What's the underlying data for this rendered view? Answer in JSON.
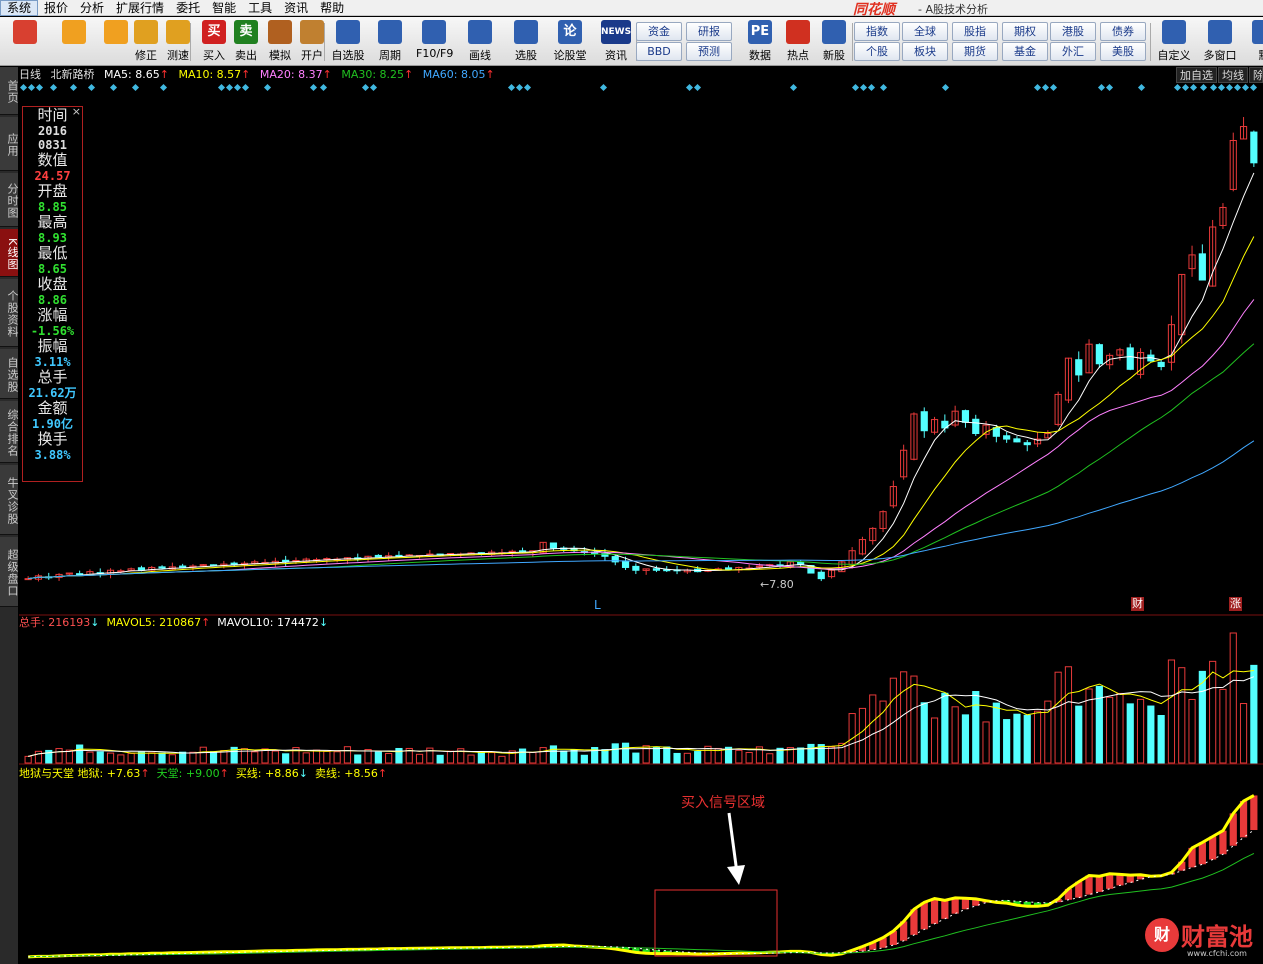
{
  "menu": {
    "items": [
      "系统",
      "报价",
      "分析",
      "扩展行情",
      "委托",
      "智能",
      "工具",
      "资讯",
      "帮助"
    ],
    "app_logo": "同花顺",
    "app_title": "- A股技术分析"
  },
  "toolbar": {
    "buttons": [
      {
        "label": "",
        "icon": "layout-icon",
        "color": "#d84030"
      },
      {
        "label": "",
        "icon": "back-arrow-icon",
        "color": "#f0a020"
      },
      {
        "label": "",
        "icon": "up-down-arrows-icon",
        "color": "#f0a020"
      },
      {
        "label": "修正",
        "icon": "clock-icon",
        "color": "#e0a020"
      },
      {
        "label": "测速",
        "icon": "stopwatch-icon",
        "color": "#e0a020"
      },
      {
        "label": "买入",
        "icon": "buy-icon",
        "glyph": "买",
        "color": "#d02020"
      },
      {
        "label": "卖出",
        "icon": "sell-icon",
        "glyph": "卖",
        "color": "#208020"
      },
      {
        "label": "模拟",
        "icon": "gavel-icon",
        "color": "#b06020"
      },
      {
        "label": "开户",
        "icon": "lock-icon",
        "color": "#c08030"
      },
      {
        "label": "自选股",
        "icon": "star-folder-icon",
        "color": "#3060b0"
      },
      {
        "label": "周期",
        "icon": "cycle-clock-icon",
        "color": "#3060b0"
      },
      {
        "label": "F10/F9",
        "icon": "f10-icon",
        "color": "#3060b0"
      },
      {
        "label": "画线",
        "icon": "pen-icon",
        "color": "#3060b0"
      },
      {
        "label": "选股",
        "icon": "screen-select-icon",
        "color": "#3060b0"
      },
      {
        "label": "论股堂",
        "icon": "discuss-icon",
        "glyph": "论",
        "color": "#3060b0"
      },
      {
        "label": "资讯",
        "icon": "news-icon",
        "glyph": "NEWS",
        "color": "#1a3a8a"
      },
      {
        "label": "数据",
        "icon": "pe-data-icon",
        "glyph": "PE",
        "color": "#3060b0"
      },
      {
        "label": "热点",
        "icon": "hot-fire-icon",
        "color": "#d03020"
      },
      {
        "label": "新股",
        "icon": "ipo-icon",
        "color": "#3060b0"
      },
      {
        "label": "自定义",
        "icon": "custom-icon",
        "color": "#3060b0"
      },
      {
        "label": "多窗口",
        "icon": "multi-window-icon",
        "color": "#3060b0"
      },
      {
        "label": "默",
        "icon": "default-icon",
        "color": "#3060b0"
      }
    ],
    "mini_buttons": [
      {
        "label": "资金"
      },
      {
        "label": "BBD"
      },
      {
        "label": "研报"
      },
      {
        "label": "预测"
      },
      {
        "label": "指数"
      },
      {
        "label": "个股"
      },
      {
        "label": "全球"
      },
      {
        "label": "板块"
      },
      {
        "label": "股指"
      },
      {
        "label": "期货"
      },
      {
        "label": "期权"
      },
      {
        "label": "基金"
      },
      {
        "label": "港股"
      },
      {
        "label": "外汇"
      },
      {
        "label": "债券"
      },
      {
        "label": "美股"
      }
    ]
  },
  "left_tabs": [
    "首页",
    "应用",
    "分时图",
    "K线图",
    "个股资料",
    "自选股",
    "综合排名",
    "牛叉诊股",
    "超级盘口"
  ],
  "header": {
    "period": "日线",
    "stock_name": "北新路桥",
    "ma5_label": "MA5:",
    "ma5": "8.65",
    "ma10_label": "MA10:",
    "ma10": "8.57",
    "ma20_label": "MA20:",
    "ma20": "8.37",
    "ma30_label": "MA30:",
    "ma30": "8.25",
    "ma60_label": "MA60:",
    "ma60": "8.05",
    "add_self": "加自选",
    "ma_line": "均线",
    "remove": "除"
  },
  "info": {
    "time_label": "时间",
    "date_year": "2016",
    "date_md": "0831",
    "value_label": "数值",
    "value": "24.57",
    "open_label": "开盘",
    "open": "8.85",
    "high_label": "最高",
    "high": "8.93",
    "low_label": "最低",
    "low": "8.65",
    "close_label": "收盘",
    "close": "8.86",
    "change_label": "涨幅",
    "change": "-1.56%",
    "amplitude_label": "振幅",
    "amplitude": "3.11%",
    "volume_label": "总手",
    "volume": "21.62万",
    "amount_label": "金额",
    "amount": "1.90亿",
    "turnover_label": "换手",
    "turnover": "3.88%"
  },
  "price_pane": {
    "low_marker": "7.80",
    "l_marker": "L",
    "cai_marker": "财",
    "zhang_marker": "涨"
  },
  "volume_pane": {
    "total_label": "总手:",
    "total": "216193",
    "mavol5_label": "MAVOL5:",
    "mavol5": "210867",
    "mavol10_label": "MAVOL10:",
    "mavol10": "174472"
  },
  "indicator_pane": {
    "name": "地狱与天堂",
    "hell_label": "地狱:",
    "hell": "+7.63",
    "heaven_label": "天堂:",
    "heaven": "+9.00",
    "buy_label": "买线:",
    "buy": "+8.86",
    "sell_label": "卖线:",
    "sell": "+8.56",
    "annotation": "买入信号区域"
  },
  "watermark": {
    "glyph": "财",
    "text": "财富池",
    "url": "www.cfchi.com"
  },
  "colors": {
    "up": "#e83a3a",
    "down": "#54ffff",
    "ma5": "#ffffff",
    "ma10": "#ffff00",
    "ma20": "#ff80ff",
    "ma30": "#20c020",
    "ma60": "#40a8ff",
    "grid": "#7a1010"
  },
  "chart_data": {
    "type": "candlestick",
    "title": "北新路桥 日线",
    "series_close": [
      7.9,
      8.0,
      7.95,
      8.05,
      8.1,
      8.02,
      8.15,
      8.1,
      8.2,
      8.18,
      8.25,
      8.2,
      8.3,
      8.28,
      8.32,
      8.3,
      8.35,
      8.4,
      8.38,
      8.42,
      8.4,
      8.45,
      8.5,
      8.48,
      8.52,
      8.5,
      8.55,
      8.6,
      8.58,
      8.62,
      8.6,
      8.65,
      8.62,
      8.7,
      8.68,
      8.72,
      8.7,
      8.75,
      8.73,
      8.78,
      8.76,
      8.8,
      8.78,
      8.82,
      8.8,
      8.85,
      8.83,
      8.88,
      8.86,
      8.9,
      9.2,
      9.0,
      8.95,
      8.9,
      8.85,
      8.8,
      8.7,
      8.5,
      8.3,
      8.2,
      8.25,
      8.2,
      8.22,
      8.18,
      8.2,
      8.15,
      8.2,
      8.25,
      8.22,
      8.3,
      8.28,
      8.35,
      8.4,
      8.38,
      8.5,
      8.4,
      8.1,
      7.9,
      8.2,
      8.5,
      8.9,
      9.3,
      9.7,
      10.3,
      11.2,
      12.5,
      13.8,
      13.2,
      13.6,
      13.3,
      13.9,
      13.5,
      13.1,
      13.4,
      13.0,
      12.9,
      12.8,
      12.7,
      12.9,
      13.1,
      14.5,
      15.8,
      15.2,
      16.3,
      15.6,
      15.9,
      16.1,
      15.4,
      16.0,
      15.7,
      15.5,
      17.0,
      18.8,
      19.5,
      18.6,
      20.5,
      21.2,
      23.6,
      24.1,
      22.8
    ]
  }
}
